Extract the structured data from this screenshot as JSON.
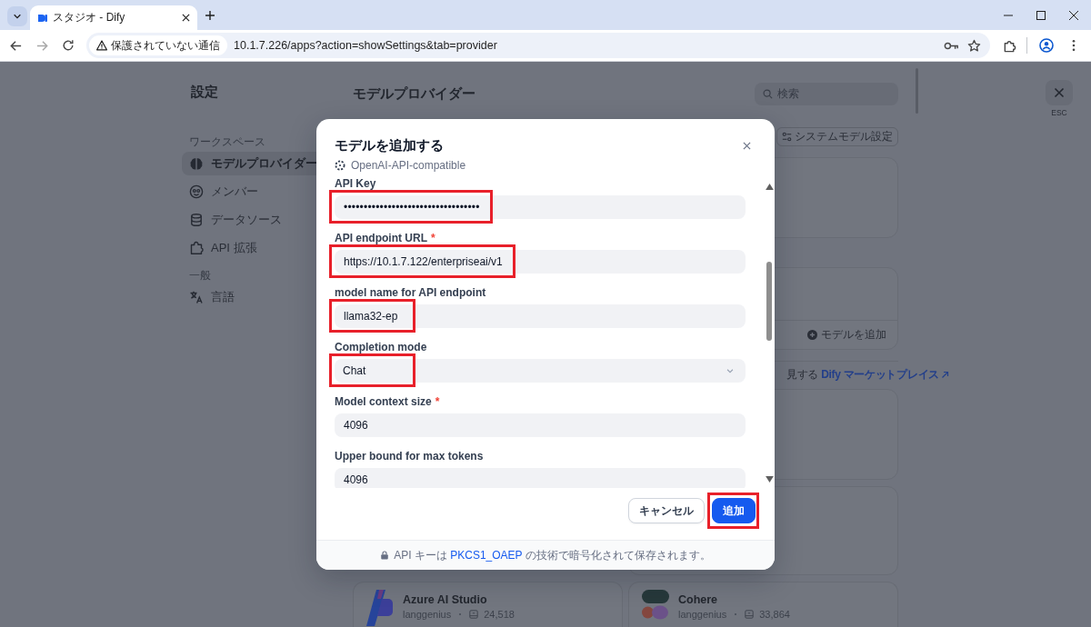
{
  "browser": {
    "tab": {
      "title": "スタジオ - Dify",
      "selected": true
    },
    "security_chip": "保護されていない通信",
    "address": "10.1.7.226/apps?action=showSettings&tab=provider"
  },
  "settings_nav": {
    "title": "設定",
    "sections": [
      {
        "heading": "ワークスペース",
        "items": [
          {
            "label": "モデルプロバイダー",
            "selected": true
          },
          {
            "label": "メンバー",
            "selected": false
          },
          {
            "label": "データソース",
            "selected": false
          },
          {
            "label": "API 拡張",
            "selected": false
          }
        ]
      },
      {
        "heading": "一般",
        "items": [
          {
            "label": "言語",
            "selected": false
          }
        ]
      }
    ]
  },
  "provider_page": {
    "title": "モデルプロバイダー",
    "search": {
      "placeholder": "検索"
    },
    "system_model_button": "システムモデル設定",
    "add_model_button": "モデルを追加",
    "marketplace": {
      "text": "見する",
      "link": "Dify マーケットプレイス"
    },
    "provider_cards": [
      {
        "name": "Azure AI Studio",
        "author": "langgenius",
        "installs": "24,518"
      },
      {
        "name": "Cohere",
        "author": "langgenius",
        "installs": "33,864"
      }
    ]
  },
  "close": {
    "hint": "ESC"
  },
  "dialog": {
    "title": "モデルを追加する",
    "provider": "OpenAI-API-compatible",
    "fields": [
      {
        "kind": "password",
        "label": "API Key",
        "value": "••••••••••••••••••••••••••••••••••",
        "highlighted": true
      },
      {
        "kind": "text",
        "label": "API endpoint URL",
        "required_mark": "*",
        "value": "https://10.1.7.122/enterpriseai/v1",
        "highlighted": true
      },
      {
        "kind": "text",
        "label": "model name for API endpoint",
        "value": "llama32-ep",
        "highlighted": true
      },
      {
        "kind": "select",
        "label": "Completion mode",
        "value": "Chat",
        "highlighted": true
      },
      {
        "kind": "text",
        "label": "Model context size",
        "required_mark": "*",
        "value": "4096",
        "highlighted": false
      },
      {
        "kind": "text",
        "label": "Upper bound for max tokens",
        "value": "4096",
        "highlighted": false
      }
    ],
    "buttons": [
      {
        "kind": "secondary",
        "label": "キャンセル",
        "highlighted": false
      },
      {
        "kind": "primary",
        "label": "追加",
        "highlighted": true
      }
    ],
    "note": {
      "before": "API キーは",
      "link": "PKCS1_OAEP",
      "after": "の技術で暗号化されて保存されます。"
    }
  }
}
